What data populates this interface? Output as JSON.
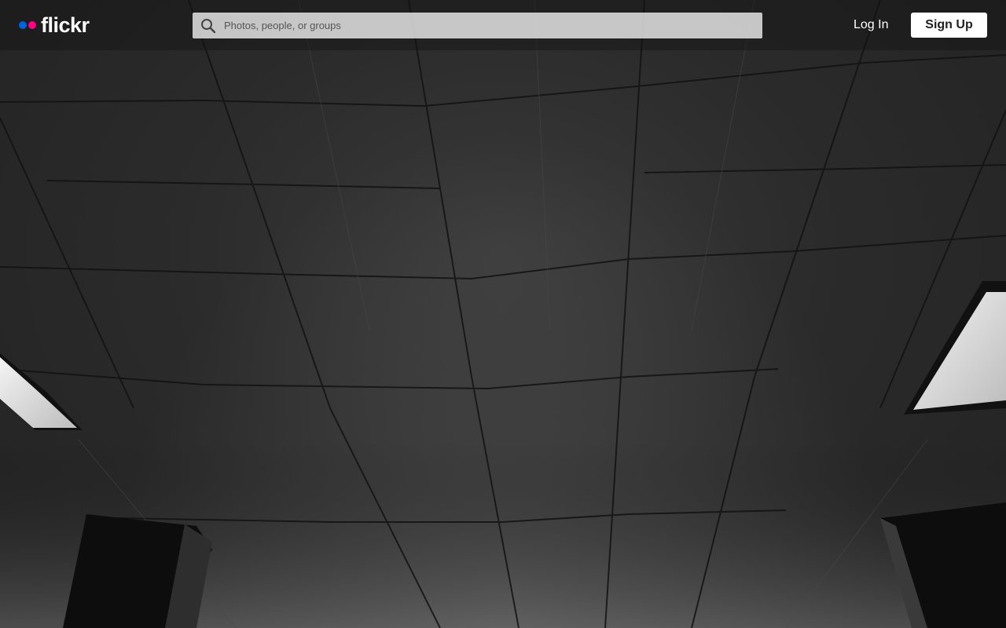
{
  "header": {
    "logo_text": "flickr",
    "logo_dot_colors": [
      "#0063dc",
      "#ff0084"
    ],
    "search": {
      "placeholder": "Photos, people, or groups",
      "value": "",
      "icon": "search-icon"
    },
    "login_label": "Log In",
    "signup_label": "Sign Up"
  },
  "hero": {
    "description_icon": "background-photo"
  }
}
